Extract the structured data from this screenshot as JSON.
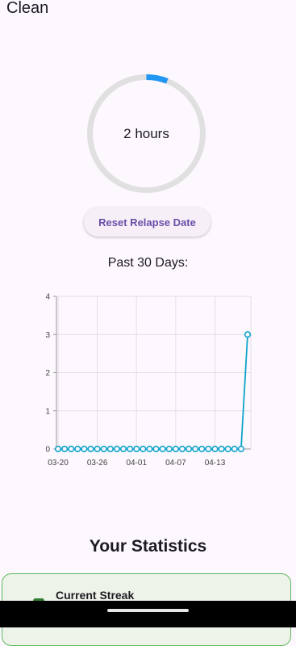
{
  "app": {
    "title": "Clean"
  },
  "progress": {
    "label": "2 hours",
    "fraction": 0.06,
    "track_color": "#e0e0e0",
    "fill_color": "#2196f3"
  },
  "reset_button": {
    "label": "Reset Relapse Date"
  },
  "history": {
    "label": "Past 30 Days:"
  },
  "chart_data": {
    "type": "line",
    "x": [
      "03-20",
      "03-21",
      "03-22",
      "03-23",
      "03-24",
      "03-25",
      "03-26",
      "03-27",
      "03-28",
      "03-29",
      "03-30",
      "03-31",
      "04-01",
      "04-02",
      "04-03",
      "04-04",
      "04-05",
      "04-06",
      "04-07",
      "04-08",
      "04-09",
      "04-10",
      "04-11",
      "04-12",
      "04-13",
      "04-14",
      "04-15",
      "04-16",
      "04-17",
      "04-18"
    ],
    "values": [
      0,
      0,
      0,
      0,
      0,
      0,
      0,
      0,
      0,
      0,
      0,
      0,
      0,
      0,
      0,
      0,
      0,
      0,
      0,
      0,
      0,
      0,
      0,
      0,
      0,
      0,
      0,
      0,
      0,
      3
    ],
    "x_tick_labels": [
      "03-20",
      "03-26",
      "04-01",
      "04-07",
      "04-13"
    ],
    "x_tick_indices": [
      0,
      6,
      12,
      18,
      24
    ],
    "y_ticks": [
      0,
      1,
      2,
      3,
      4
    ],
    "ylim": [
      0,
      4
    ],
    "grid": true,
    "color": "#0ea5c9"
  },
  "statistics": {
    "heading": "Your Statistics",
    "cards": [
      {
        "title": "Current Streak",
        "accent": "#5cb85c"
      }
    ]
  }
}
